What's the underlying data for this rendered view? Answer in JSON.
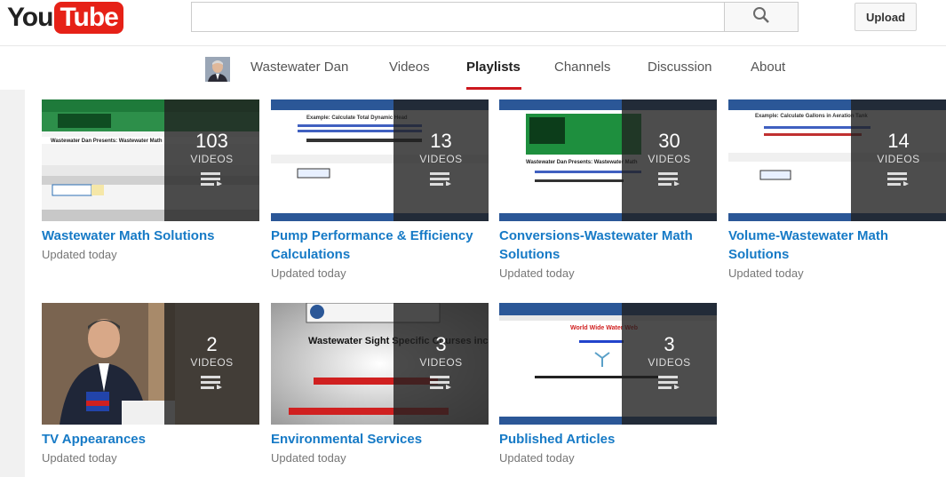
{
  "masthead": {
    "logo_you": "You",
    "logo_tube": "Tube",
    "search_placeholder": "",
    "search_icon": "search-icon",
    "upload_label": "Upload"
  },
  "channel": {
    "name": "Wastewater Dan",
    "tabs": [
      {
        "label": "Videos",
        "active": false
      },
      {
        "label": "Playlists",
        "active": true
      },
      {
        "label": "Channels",
        "active": false
      },
      {
        "label": "Discussion",
        "active": false
      },
      {
        "label": "About",
        "active": false
      }
    ]
  },
  "colors": {
    "brand_red": "#e62117",
    "link_blue": "#167ac6",
    "tab_underline": "#cc181e"
  },
  "playlists": [
    {
      "title": "Wastewater Math Solutions",
      "count": "103",
      "count_label": "VIDEOS",
      "updated": "Updated today",
      "thumb_text": "Wastewater Dan Presents: Wastewater Math"
    },
    {
      "title": "Pump Performance & Efficiency Calculations",
      "count": "13",
      "count_label": "VIDEOS",
      "updated": "Updated today",
      "thumb_text": "Example: Calculate Total Dynamic Head"
    },
    {
      "title": "Conversions-Wastewater Math Solutions",
      "count": "30",
      "count_label": "VIDEOS",
      "updated": "Updated today",
      "thumb_text": "Wastewater Dan Presents: Wastewater Math"
    },
    {
      "title": "Volume-Wastewater Math Solutions",
      "count": "14",
      "count_label": "VIDEOS",
      "updated": "Updated today",
      "thumb_text": "Example: Calculate Gallons in Aeration Tank"
    },
    {
      "title": "TV Appearances",
      "count": "2",
      "count_label": "VIDEOS",
      "updated": "Updated today",
      "thumb_text": ""
    },
    {
      "title": "Environmental Services",
      "count": "3",
      "count_label": "VIDEOS",
      "updated": "Updated today",
      "thumb_text": "Wastewater Sight Specific Courses include"
    },
    {
      "title": "Published Articles",
      "count": "3",
      "count_label": "VIDEOS",
      "updated": "Updated today",
      "thumb_text": "World Wide Water Web"
    }
  ]
}
